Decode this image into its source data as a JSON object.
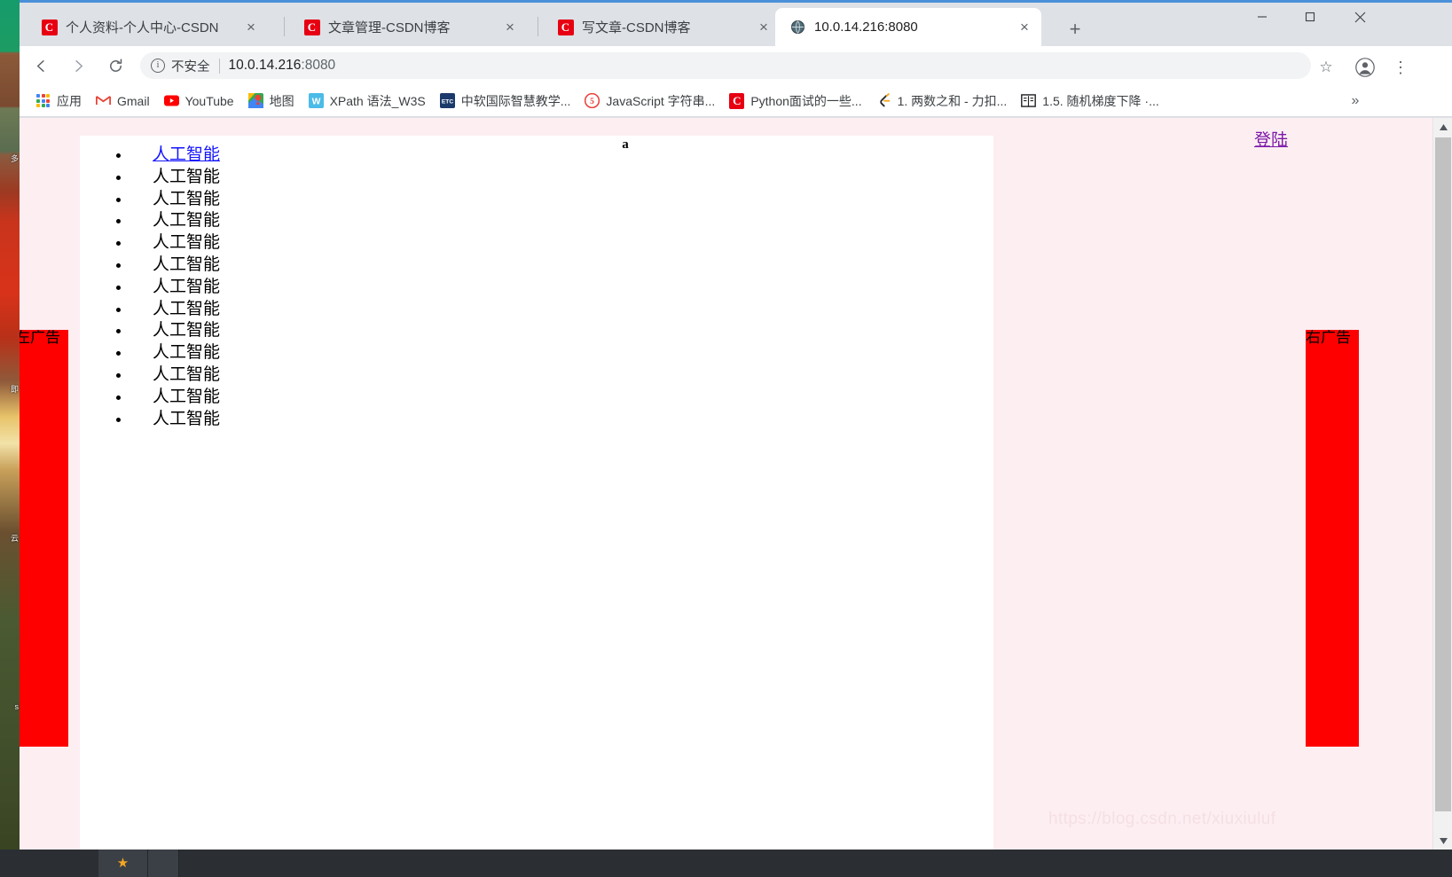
{
  "browser": {
    "tabs": [
      {
        "title": "个人资料-个人中心-CSDN",
        "favicon": "csdn-icon",
        "active": false
      },
      {
        "title": "文章管理-CSDN博客",
        "favicon": "csdn-icon",
        "active": false
      },
      {
        "title": "写文章-CSDN博客",
        "favicon": "csdn-icon",
        "active": false
      },
      {
        "title": "10.0.14.216:8080",
        "favicon": "globe-icon",
        "active": true
      }
    ],
    "tab_close_label": "×",
    "new_tab_label": "+",
    "window_controls": {
      "minimize": "─",
      "maximize": "□",
      "close": "✕"
    },
    "toolbar": {
      "back": "←",
      "forward": "→",
      "reload": "⟳",
      "security_label": "不安全",
      "url_host": "10.0.14.216",
      "url_rest": ":8080",
      "bookmark_star": "☆",
      "menu": "⋮"
    },
    "bookmarks": {
      "items": [
        {
          "label": "应用",
          "icon": "apps-grid-icon"
        },
        {
          "label": "Gmail",
          "icon": "gmail-icon"
        },
        {
          "label": "YouTube",
          "icon": "youtube-icon"
        },
        {
          "label": "地图",
          "icon": "maps-icon"
        },
        {
          "label": "XPath 语法_W3S",
          "icon": "w3s-icon"
        },
        {
          "label": "中软国际智慧教学...",
          "icon": "etc-icon"
        },
        {
          "label": "JavaScript 字符串...",
          "icon": "js-icon"
        },
        {
          "label": "Python面试的一些...",
          "icon": "csdn-icon"
        },
        {
          "label": "1. 两数之和 - 力扣...",
          "icon": "leetcode-icon"
        },
        {
          "label": "1.5. 随机梯度下降 ·...",
          "icon": "book-icon"
        }
      ],
      "overflow_label": "»"
    },
    "scrollbar": {
      "up_arrow": "▲",
      "down_arrow": "▼"
    }
  },
  "page": {
    "background_color": "#fdeef2",
    "center_label": "a",
    "login_link": "登陆",
    "list": {
      "items": [
        {
          "text": "人工智能",
          "is_link": true
        },
        {
          "text": "人工智能",
          "is_link": false
        },
        {
          "text": "人工智能",
          "is_link": false
        },
        {
          "text": "人工智能",
          "is_link": false
        },
        {
          "text": "人工智能",
          "is_link": false
        },
        {
          "text": "人工智能",
          "is_link": false
        },
        {
          "text": "人工智能",
          "is_link": false
        },
        {
          "text": "人工智能",
          "is_link": false
        },
        {
          "text": "人工智能",
          "is_link": false
        },
        {
          "text": "人工智能",
          "is_link": false
        },
        {
          "text": "人工智能",
          "is_link": false
        },
        {
          "text": "人工智能",
          "is_link": false
        },
        {
          "text": "人工智能",
          "is_link": false
        }
      ]
    },
    "ads": {
      "left_label": "左广告",
      "right_label": "右广告",
      "color": "#ff0000"
    },
    "watermark": "https://blog.csdn.net/xiuxiuluf"
  },
  "desktop": {
    "strip_labels": [
      "多",
      "即",
      "云",
      "s"
    ]
  }
}
